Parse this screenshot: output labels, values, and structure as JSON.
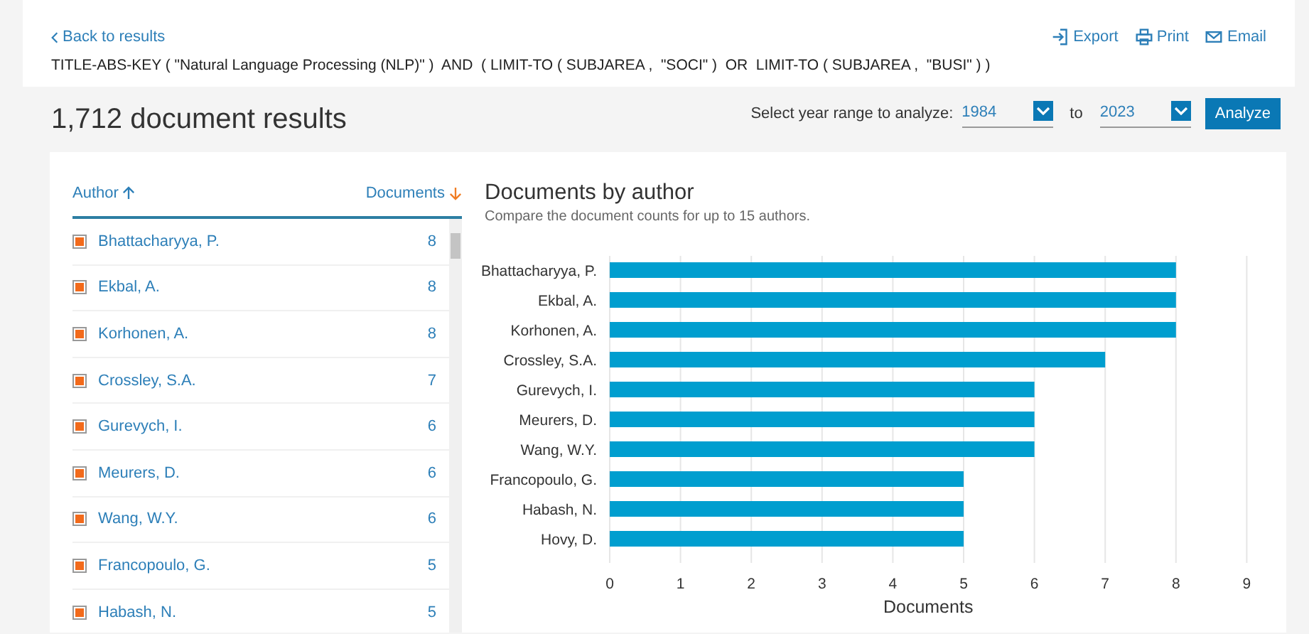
{
  "header": {
    "back_link": "Back to results",
    "actions": [
      {
        "kind": "export",
        "label": "Export"
      },
      {
        "kind": "print",
        "label": "Print"
      },
      {
        "kind": "email",
        "label": "Email"
      }
    ],
    "query": "TITLE-ABS-KEY ( \"Natural Language Processing (NLP)\" )  AND  ( LIMIT-TO ( SUBJAREA ,  \"SOCI\" )  OR  LIMIT-TO ( SUBJAREA ,  \"BUSI\" ) )"
  },
  "results_title": "1,712 document results",
  "year_range": {
    "label": "Select year range to analyze:",
    "from": "1984",
    "separator": "to",
    "to": "2023",
    "button": "Analyze"
  },
  "author_table": {
    "columns": [
      {
        "label": "Author",
        "sort_ascending": true
      },
      {
        "label": "Documents",
        "sort_ascending": false
      }
    ],
    "rows": [
      {
        "name": "Bhattacharyya, P.",
        "count": "8",
        "checked": true
      },
      {
        "name": "Ekbal, A.",
        "count": "8",
        "checked": true
      },
      {
        "name": "Korhonen, A.",
        "count": "8",
        "checked": true
      },
      {
        "name": "Crossley, S.A.",
        "count": "7",
        "checked": true
      },
      {
        "name": "Gurevych, I.",
        "count": "6",
        "checked": true
      },
      {
        "name": "Meurers, D.",
        "count": "6",
        "checked": true
      },
      {
        "name": "Wang, W.Y.",
        "count": "6",
        "checked": true
      },
      {
        "name": "Francopoulo, G.",
        "count": "5",
        "checked": true
      },
      {
        "name": "Habash, N.",
        "count": "5",
        "checked": true
      }
    ]
  },
  "chart_panel": {
    "title": "Documents by author",
    "subtitle": "Compare the document counts for up to 15 authors.",
    "chart_data": {
      "type": "bar",
      "orientation": "horizontal",
      "xlabel": "Documents",
      "categories": [
        "Bhattacharyya, P.",
        "Ekbal, A.",
        "Korhonen, A.",
        "Crossley, S.A.",
        "Gurevych, I.",
        "Meurers, D.",
        "Wang, W.Y.",
        "Francopoulo, G.",
        "Habash, N.",
        "Hovy, D."
      ],
      "series": [
        {
          "color": "#009ecf",
          "values": [
            8,
            8,
            8,
            7,
            6,
            6,
            6,
            5,
            5,
            5
          ]
        }
      ],
      "grid": true,
      "xlim": [
        0,
        9
      ],
      "xticks": [
        0,
        1,
        2,
        3,
        4,
        5,
        6,
        7,
        8,
        9
      ]
    }
  }
}
